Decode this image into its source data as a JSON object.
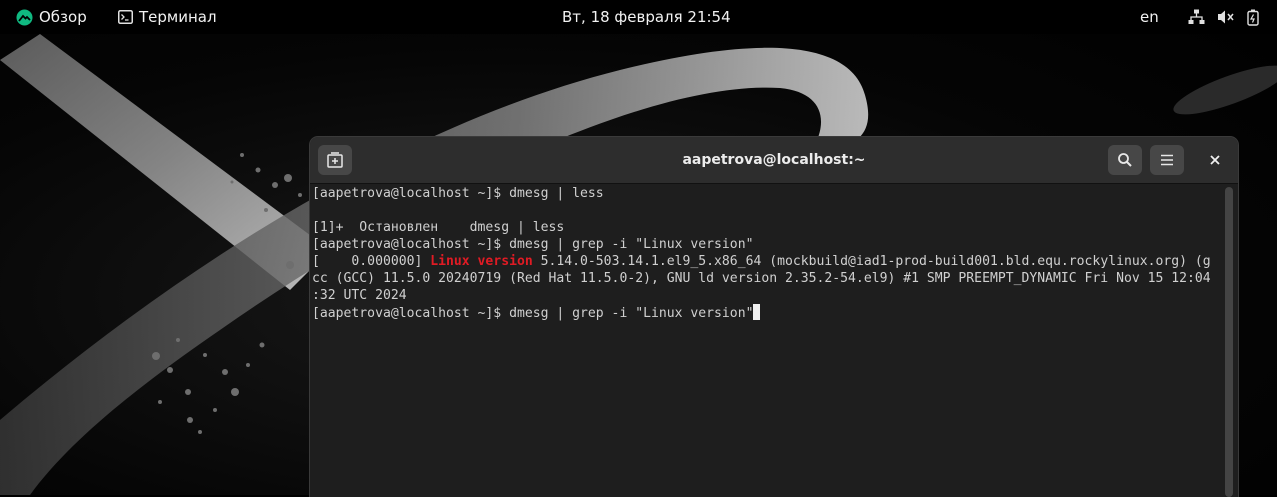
{
  "topbar": {
    "activities_label": "Обзор",
    "app_label": "Терминал",
    "clock": "Вт, 18 февраля  21:54",
    "keyboard_layout": "en"
  },
  "window": {
    "title": "aapetrova@localhost:~"
  },
  "terminal": {
    "lines": [
      "[aapetrova@localhost ~]$ dmesg | less",
      "",
      "[1]+  Остановлен    dmesg | less",
      "[aapetrova@localhost ~]$ dmesg | grep -i \"Linux version\""
    ],
    "kernel_line": {
      "prefix": "[    0.000000] ",
      "highlight": "Linux version",
      "rest": " 5.14.0-503.14.1.el9_5.x86_64 (mockbuild@iad1-prod-build001.bld.equ.rockylinux.org) (g"
    },
    "wrapped_lines": [
      "cc (GCC) 11.5.0 20240719 (Red Hat 11.5.0-2), GNU ld version 2.35.2-54.el9) #1 SMP PREEMPT_DYNAMIC Fri Nov 15 12:04",
      ":32 UTC 2024"
    ],
    "current_prompt": "[aapetrova@localhost ~]$ dmesg | grep -i \"Linux version\""
  },
  "colors": {
    "highlight": "#e01b24",
    "terminal_bg": "#1e1e1e",
    "headerbar_bg": "#2d2d2d"
  },
  "icons": {
    "activities": "rocky-logo-icon",
    "app": "terminal-app-icon",
    "new_tab": "new-tab-icon",
    "search": "search-icon",
    "menu": "hamburger-menu-icon",
    "close": "close-icon",
    "network": "network-icon",
    "volume": "volume-muted-icon",
    "battery": "battery-icon"
  }
}
